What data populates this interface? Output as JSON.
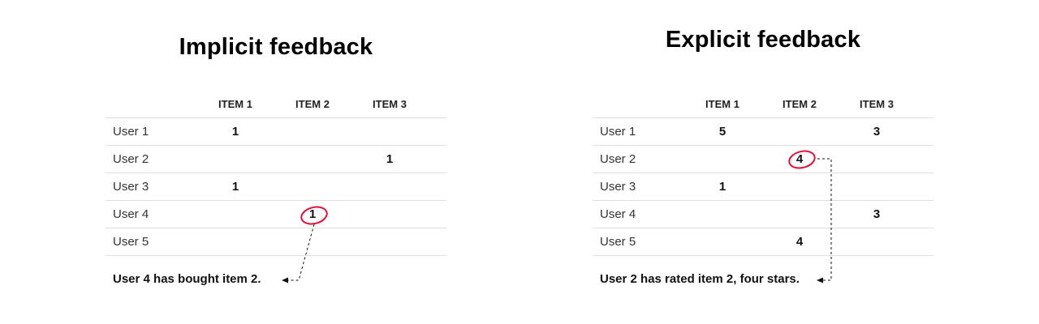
{
  "accent_color": "#e0103a",
  "panels": {
    "implicit": {
      "title": "Implicit feedback",
      "columns": [
        "ITEM 1",
        "ITEM 2",
        "ITEM 3"
      ],
      "rows": [
        {
          "user": "User 1",
          "values": [
            "1",
            "",
            ""
          ]
        },
        {
          "user": "User 2",
          "values": [
            "",
            "",
            "1"
          ]
        },
        {
          "user": "User 3",
          "values": [
            "1",
            "",
            ""
          ]
        },
        {
          "user": "User 4",
          "values": [
            "",
            "1",
            ""
          ]
        },
        {
          "user": "User 5",
          "values": [
            "",
            "",
            ""
          ]
        }
      ],
      "highlight": {
        "row": 4,
        "column": 2
      },
      "caption": "User 4 has bought item 2."
    },
    "explicit": {
      "title": "Explicit feedback",
      "columns": [
        "ITEM 1",
        "ITEM 2",
        "ITEM 3"
      ],
      "rows": [
        {
          "user": "User 1",
          "values": [
            "5",
            "",
            "3"
          ]
        },
        {
          "user": "User 2",
          "values": [
            "",
            "4",
            ""
          ]
        },
        {
          "user": "User 3",
          "values": [
            "1",
            "",
            ""
          ]
        },
        {
          "user": "User 4",
          "values": [
            "",
            "",
            "3"
          ]
        },
        {
          "user": "User 5",
          "values": [
            "",
            "4",
            ""
          ]
        }
      ],
      "highlight": {
        "row": 2,
        "column": 2
      },
      "caption": "User 2 has rated item 2, four stars."
    }
  }
}
